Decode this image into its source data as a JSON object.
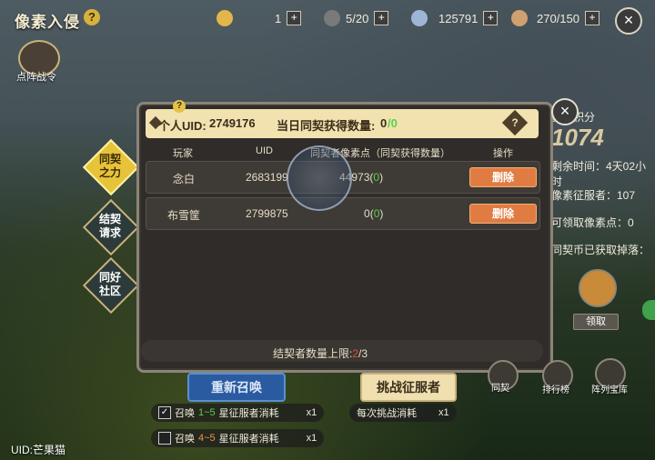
{
  "game": {
    "title": "像素入侵",
    "help": "?"
  },
  "resources": [
    {
      "icon": "coin-icon",
      "value": "1",
      "color": "#e2b64a"
    },
    {
      "icon": "cross-swords-icon",
      "value": "5/20",
      "color": "#b9b9b9"
    },
    {
      "icon": "pixel-shard-icon",
      "value": "125791",
      "color": "#9fb5d6"
    },
    {
      "icon": "energy-feather-icon",
      "value": "270/150",
      "color": "#d0a070"
    }
  ],
  "left_menu": {
    "order_label": "点阵战令",
    "items": [
      {
        "label_1": "同契",
        "label_2": "之力",
        "active": true
      },
      {
        "label_1": "结契",
        "label_2": "请求",
        "active": false
      },
      {
        "label_1": "同好",
        "label_2": "社区",
        "active": false
      }
    ]
  },
  "modal": {
    "uid_label": "个人UID:",
    "uid_value": "2749176",
    "daily_label": "当日同契获得数量:",
    "daily_value": "0",
    "daily_max": "/0",
    "info_q": "?",
    "columns": {
      "player": "玩家",
      "uid": "UID",
      "points": "同契者像素点（同契获得数量）",
      "action": "操作"
    },
    "rows": [
      {
        "name": "念白",
        "uid": "2683199",
        "points": "44973",
        "gain": "0",
        "action": "删除"
      },
      {
        "name": "布雪筐",
        "uid": "2799875",
        "points": "0",
        "gain": "0",
        "action": "删除"
      }
    ],
    "limit_label": "结契者数量上限:",
    "limit_current": "2",
    "limit_max": "/3"
  },
  "right_panel": {
    "points_tag": "贡献积分",
    "big_number": "1074",
    "countdown": "剩余时间：4天02小时",
    "conquerors": "像素征服者：107",
    "pixel_points": "可领取像素点：0",
    "drop": "同契币已获取掉落：",
    "claim": "领取"
  },
  "bottom": {
    "resummon": "重新召唤",
    "challenge": "挑战征服者",
    "cost1_pre": "召唤",
    "cost1_range": "1~5",
    "cost1_post": "星征服者消耗",
    "cost1_qty": "x1",
    "cost2_pre": "召唤",
    "cost2_range": "4~5",
    "cost2_post": "星征服者消耗",
    "cost2_qty": "x1",
    "daily_challenge": "每次挑战消耗",
    "daily_challenge_qty": "x1",
    "tab_contract": "同契",
    "tab_rank": "排行榜",
    "tab_library": "阵列宝库",
    "uid_footer": "UID:芒果猫"
  }
}
